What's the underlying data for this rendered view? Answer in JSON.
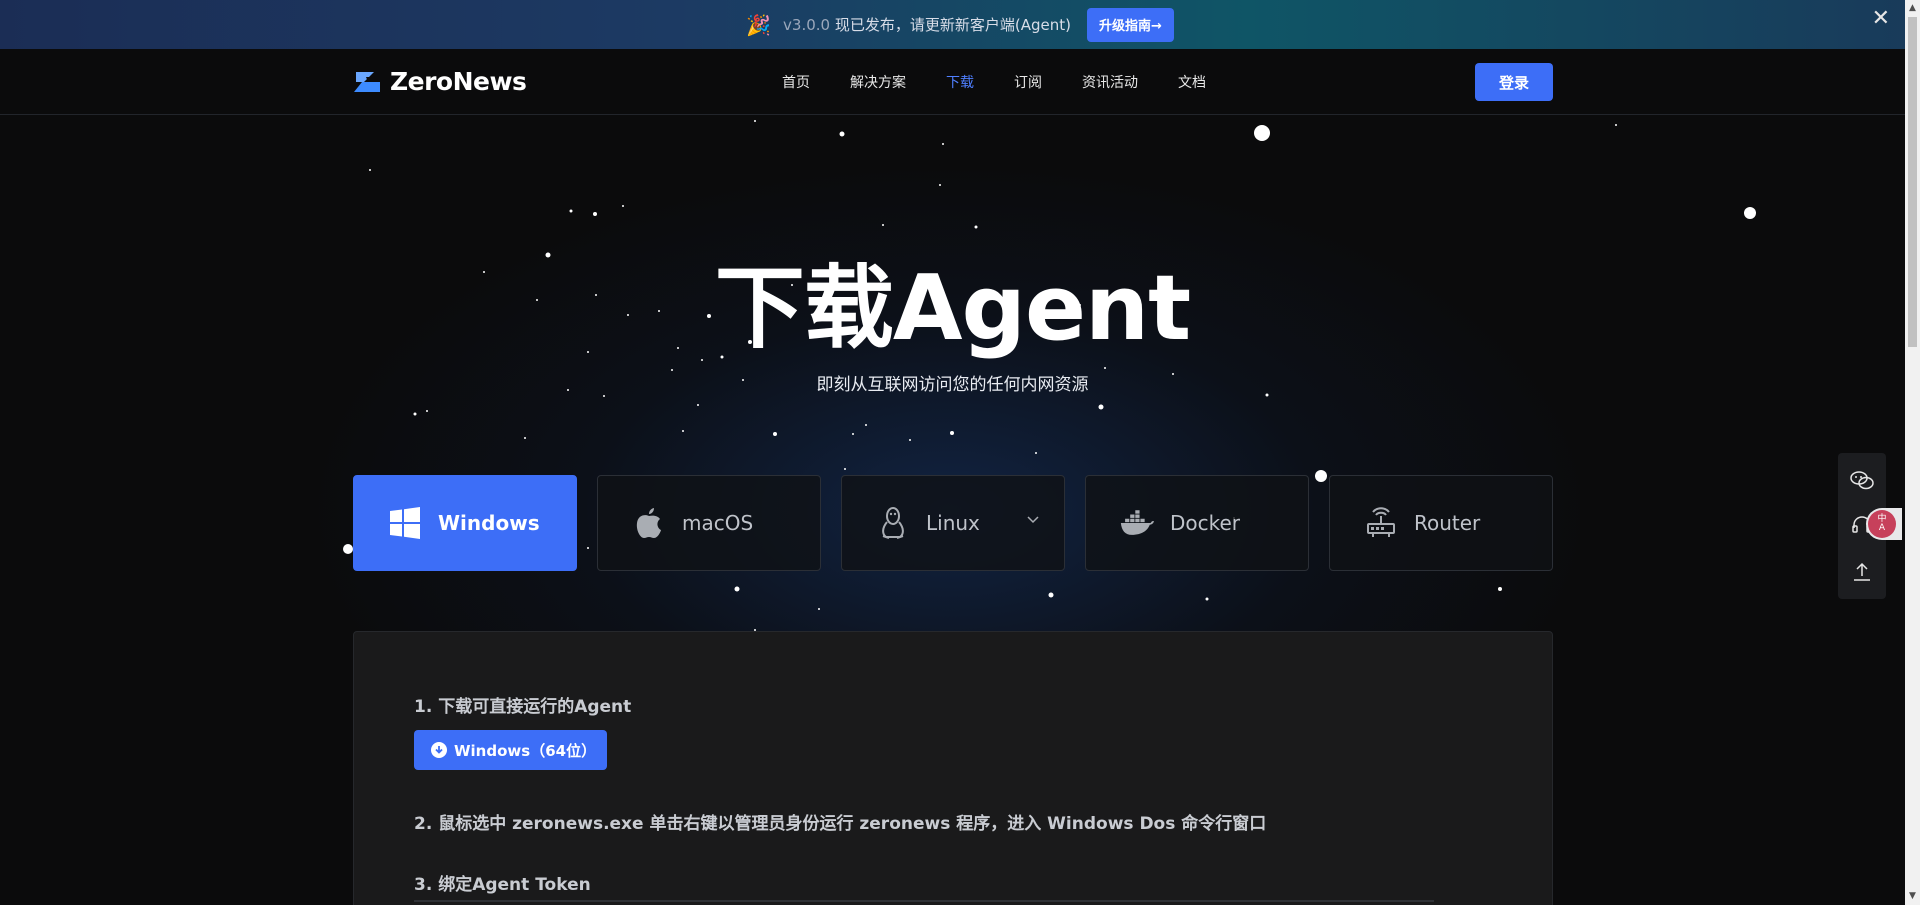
{
  "announcement": {
    "icon": "party-popper-icon",
    "version": "v3.0.0",
    "text": "现已发布，请更新新客户端(Agent)",
    "button_label": "升级指南→",
    "close": "✕"
  },
  "header": {
    "logo_text": "ZeroNews",
    "nav": [
      {
        "label": "首页",
        "active": false
      },
      {
        "label": "解决方案",
        "active": false
      },
      {
        "label": "下载",
        "active": true
      },
      {
        "label": "订阅",
        "active": false
      },
      {
        "label": "资讯活动",
        "active": false
      },
      {
        "label": "文档",
        "active": false
      }
    ],
    "login_label": "登录"
  },
  "hero": {
    "title": "下载Agent",
    "subtitle": "即刻从互联网访问您的任何内网资源"
  },
  "platform_tabs": [
    {
      "label": "Windows",
      "icon": "windows-icon",
      "active": true
    },
    {
      "label": "macOS",
      "icon": "apple-icon",
      "active": false
    },
    {
      "label": "Linux",
      "icon": "linux-icon",
      "active": false,
      "has_dropdown": true
    },
    {
      "label": "Docker",
      "icon": "docker-icon",
      "active": false
    },
    {
      "label": "Router",
      "icon": "router-icon",
      "active": false
    }
  ],
  "content": {
    "step1": "1. 下载可直接运行的Agent",
    "download_button": "Windows（64位）",
    "step2": "2. 鼠标选中 zeronews.exe 单击右键以管理员身份运行 zeronews 程序，进入 Windows Dos 命令行窗口",
    "step3": "3. 绑定Agent Token"
  },
  "side_toolbar": {
    "items": [
      "wechat-icon",
      "customer-service-icon",
      "back-to-top-icon"
    ]
  },
  "colors": {
    "accent": "#3d6ef7",
    "background": "#0b0b0c",
    "card": "#1a1a1b"
  }
}
